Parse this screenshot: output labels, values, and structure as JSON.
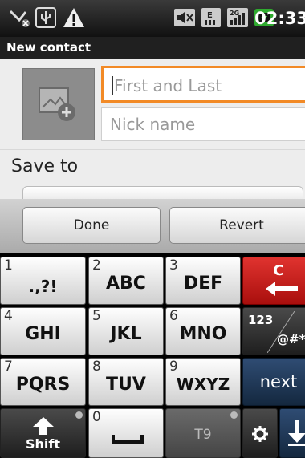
{
  "status_bar": {
    "time": "02:33",
    "icons": [
      "missed-call-icon",
      "usb-icon",
      "warning-icon",
      "mute-icon",
      "network-e-icon",
      "signal-icon",
      "battery-icon"
    ]
  },
  "title_bar": {
    "title": "New contact"
  },
  "form": {
    "first_last_placeholder": "First and Last",
    "nick_placeholder": "Nick name",
    "save_to_label": "Save to"
  },
  "actions": {
    "done_label": "Done",
    "revert_label": "Revert"
  },
  "keyboard": {
    "keys": [
      {
        "num": "1",
        "label": ".,?!"
      },
      {
        "num": "2",
        "label": "ABC"
      },
      {
        "num": "3",
        "label": "DEF"
      },
      {
        "num": "",
        "label": "C"
      },
      {
        "num": "4",
        "label": "GHI"
      },
      {
        "num": "5",
        "label": "JKL"
      },
      {
        "num": "6",
        "label": "MNO"
      },
      {
        "num": "",
        "label": "123"
      },
      {
        "num": "7",
        "label": "PQRS"
      },
      {
        "num": "8",
        "label": "TUV"
      },
      {
        "num": "9",
        "label": "WXYZ"
      },
      {
        "num": "",
        "label": "next"
      },
      {
        "num": "",
        "label": "Shift"
      },
      {
        "num": "0",
        "label": ""
      },
      {
        "num": "",
        "label": "T9"
      }
    ],
    "symbols_sub": "@#*"
  },
  "colors": {
    "focus_orange": "#f28a26",
    "clear_red": "#c71f1c",
    "next_navy": "#1f3857"
  }
}
